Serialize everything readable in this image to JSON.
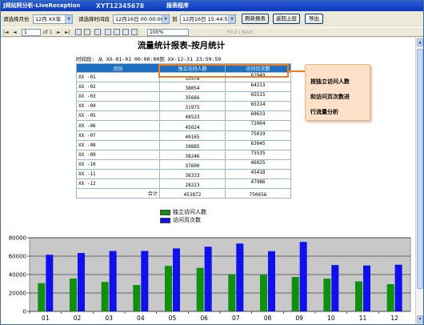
{
  "window": {
    "title": "J网站阿分析-LiveReception",
    "title_stamp": "XYT12345678",
    "title_suffix": "报表程序"
  },
  "filters": {
    "month_label": "请选择月份",
    "month_value": "12月 XX年",
    "period_label": "请选择时间段",
    "start_value": "12月16日 00:00:00",
    "to_label": "到",
    "end_value": "12月16日 15:44:57",
    "refresh_button": "刷新报表",
    "back_button": "返回上层",
    "export_button": "导出"
  },
  "toolbar": {
    "page_current": "1",
    "page_of": "of 1",
    "find_next": "Find | Next",
    "zoom": "100%"
  },
  "report": {
    "title": "流量统计报表-按月统计",
    "period": "时间段: 从  XX-01-01 00:00:00到  XX-12-31 23:59:59",
    "columns": [
      "月份",
      "独立访问人数",
      "访问页次数"
    ],
    "rows": [
      {
        "month": "XX -01",
        "uv": "33578",
        "pv": "61949"
      },
      {
        "month": "XX -02",
        "uv": "38054",
        "pv": "64213"
      },
      {
        "month": "XX -03",
        "uv": "35666",
        "pv": "65515"
      },
      {
        "month": "XX -04",
        "uv": "31975",
        "pv": "65314"
      },
      {
        "month": "XX -05",
        "uv": "48523",
        "pv": "68633"
      },
      {
        "month": "XX -06",
        "uv": "45624",
        "pv": "72004"
      },
      {
        "month": "XX -07",
        "uv": "40165",
        "pv": "75019"
      },
      {
        "month": "XX -08",
        "uv": "39885",
        "pv": "63045"
      },
      {
        "month": "XX -09",
        "uv": "38246",
        "pv": "75535"
      },
      {
        "month": "XX -10",
        "uv": "37600",
        "pv": "46025"
      },
      {
        "month": "XX -11",
        "uv": "36333",
        "pv": "45418"
      },
      {
        "month": "XX -12",
        "uv": "28223",
        "pv": "47986"
      }
    ],
    "total_label": "合计",
    "total_uv": "453872",
    "total_pv": "750656"
  },
  "callout": {
    "lines": [
      "按独立访问人数",
      "和访问页次数进",
      "行流量分析"
    ]
  },
  "legend": {
    "series1": "独立访问人数",
    "series2": "访问页次数"
  },
  "colors": {
    "series1": "#109010",
    "series2": "#1010ee",
    "header": "#1f6fc0",
    "highlight": "#f07c1b",
    "callout_bg": "#fce1c8",
    "plot_bg": "#c8c8c8"
  },
  "chart_data": {
    "type": "bar",
    "categories": [
      "01",
      "02",
      "03",
      "04",
      "05",
      "06",
      "07",
      "08",
      "09",
      "10",
      "11",
      "12"
    ],
    "series": [
      {
        "name": "独立访问人数",
        "values": [
          30700,
          35700,
          32000,
          28700,
          49500,
          47300,
          40400,
          39800,
          37400,
          35600,
          32600,
          29600
        ]
      },
      {
        "name": "访问页次数",
        "values": [
          61500,
          63400,
          65600,
          65600,
          68400,
          70300,
          73700,
          65400,
          75500,
          50300,
          49900,
          50700
        ]
      }
    ],
    "ylim": [
      0,
      80000
    ],
    "yticks": [
      "0",
      "20000",
      "40000",
      "60000",
      "80000"
    ],
    "grid": true,
    "legend_position": "top-center"
  }
}
